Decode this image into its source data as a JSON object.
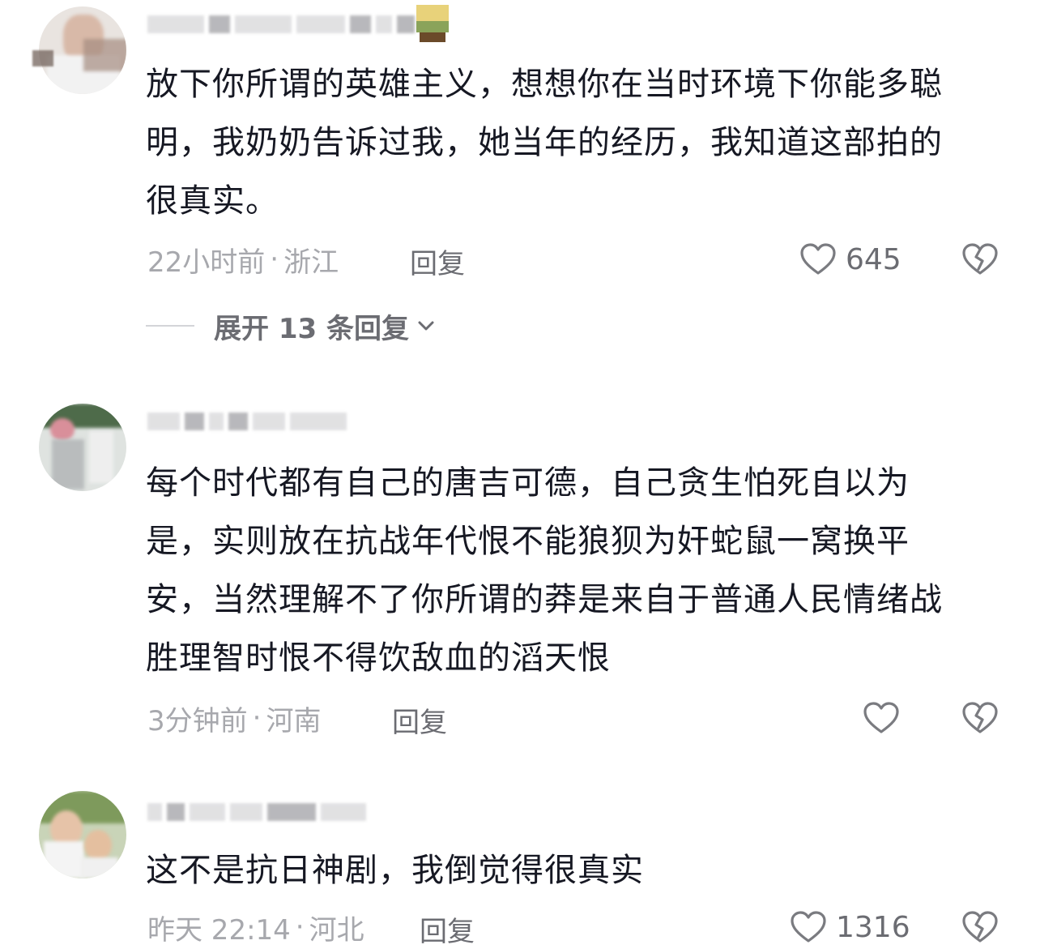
{
  "comments": [
    {
      "text": "放下你所谓的英雄主义，想想你在当时环境下你能多聪明，我奶奶告诉过我，她当年的经历，我知道这部拍的很真实。",
      "time": "22小时前",
      "location": "浙江",
      "reply_label": "回复",
      "like_count": "645"
    },
    {
      "text": "每个时代都有自己的唐吉可德，自己贪生怕死自以为是，实则放在抗战年代恨不能狼狈为奸蛇鼠一窝换平安，当然理解不了你所谓的莽是来自于普通人民情绪战胜理智时恨不得饮敌血的滔天恨",
      "time": "3分钟前",
      "location": "河南",
      "reply_label": "回复",
      "like_count": ""
    },
    {
      "text": "这不是抗日神剧，我倒觉得很真实",
      "time": "昨天 22:14",
      "location": "河北",
      "reply_label": "回复",
      "like_count": "1316"
    }
  ],
  "expand_replies": {
    "label": "展开 13 条回复"
  },
  "meta_separator": "·",
  "icons": {
    "like": "heart-outline-icon",
    "dislike": "broken-heart-icon",
    "expand": "chevron-down-icon"
  },
  "colors": {
    "text_primary": "#161823",
    "text_secondary": "#a7a8ad",
    "text_action": "#6b6c72"
  }
}
